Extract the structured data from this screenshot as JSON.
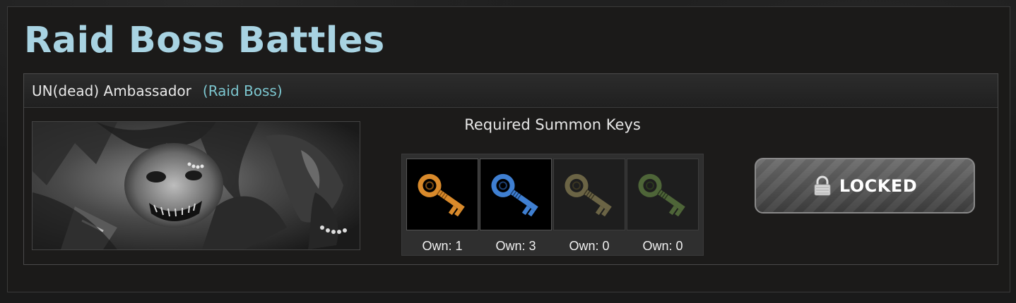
{
  "page": {
    "title": "Raid Boss Battles"
  },
  "raid": {
    "boss_name": "UN(dead) Ambassador",
    "boss_type": "(Raid Boss)",
    "image_icon": "undead-boss-portrait"
  },
  "summon_keys": {
    "title": "Required Summon Keys",
    "keys": [
      {
        "icon": "gold-key-icon",
        "color": "#d98a2b",
        "own_label": "Own: 1"
      },
      {
        "icon": "blue-key-icon",
        "color": "#3f7fd1",
        "own_label": "Own: 3"
      },
      {
        "icon": "bronze-key-icon",
        "color": "#6b6445",
        "own_label": "Own: 0"
      },
      {
        "icon": "green-key-icon",
        "color": "#4e6538",
        "own_label": "Own: 0"
      }
    ]
  },
  "action": {
    "label": "LOCKED",
    "icon": "padlock-icon"
  },
  "colors": {
    "title": "#a8d3e2",
    "boss_type": "#7cc6cf"
  }
}
